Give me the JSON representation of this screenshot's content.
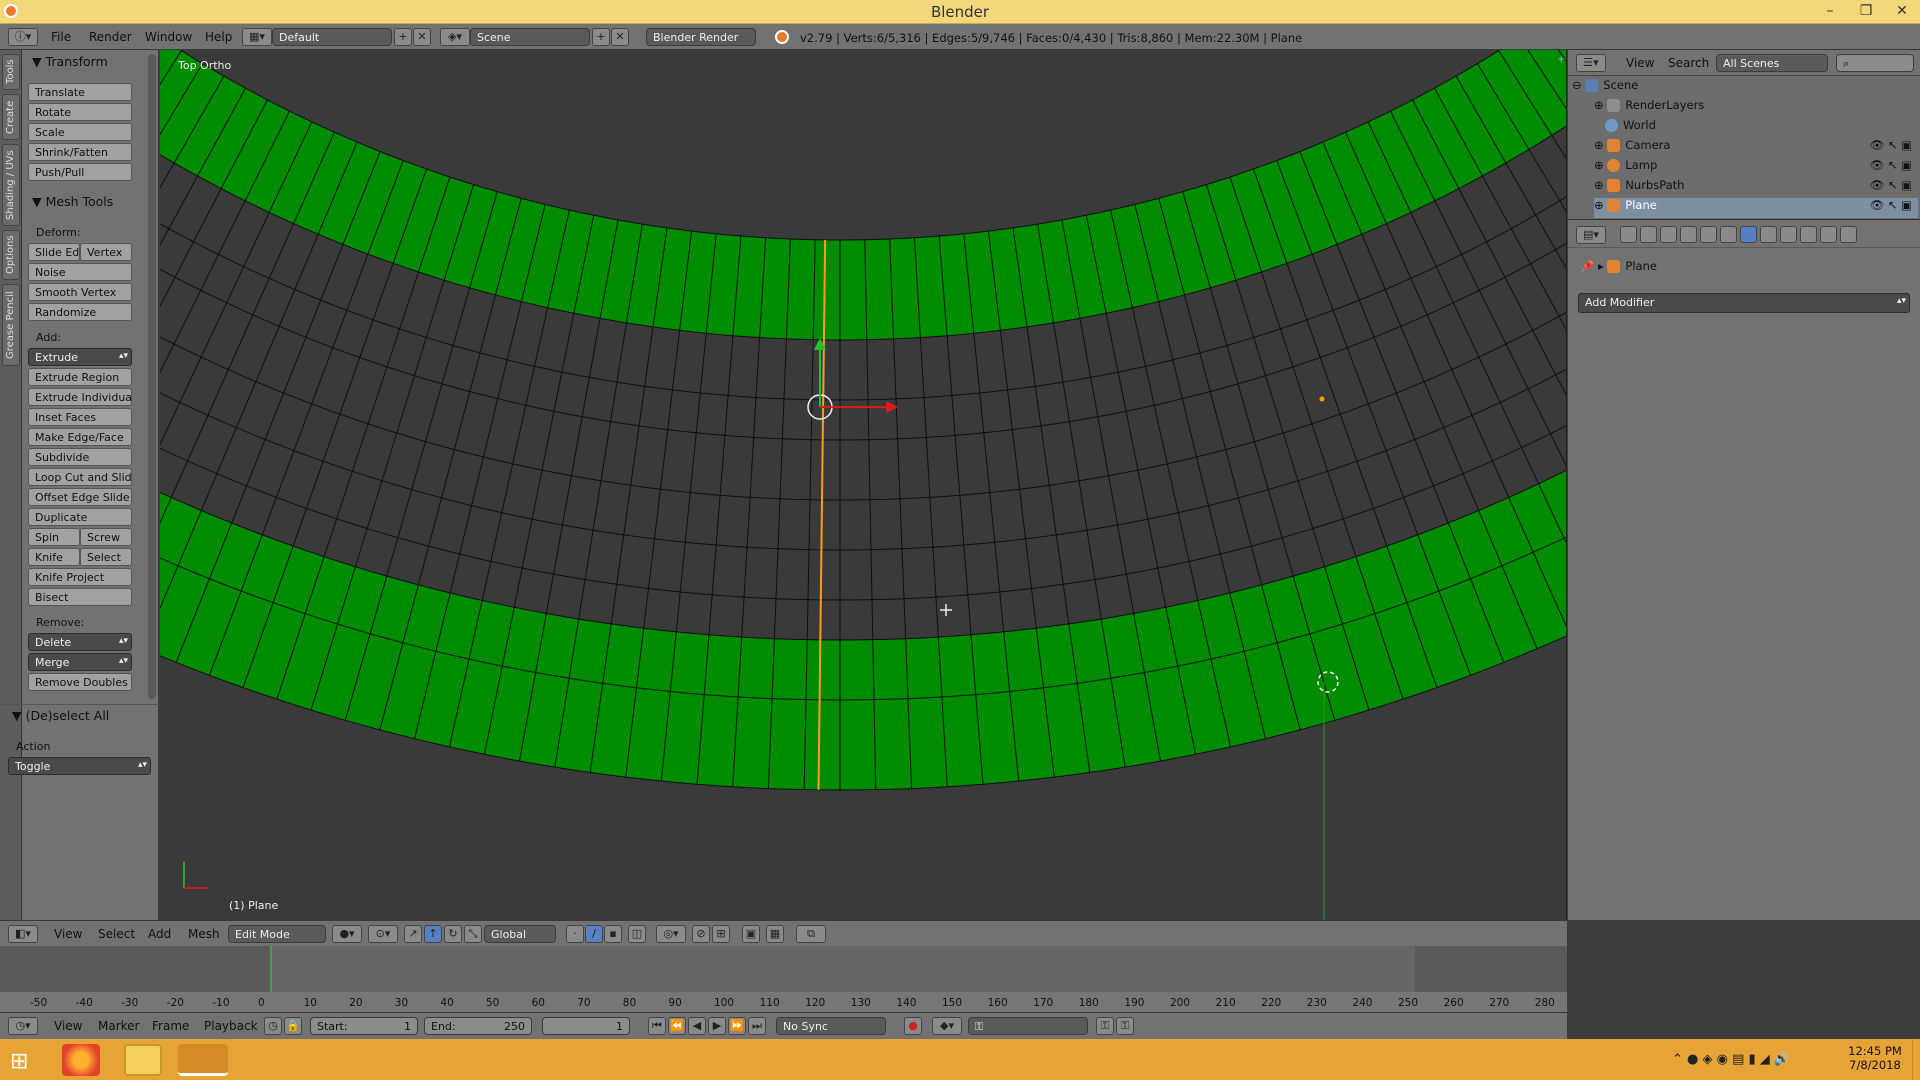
{
  "window": {
    "title": "Blender"
  },
  "info": {
    "menu": [
      "File",
      "Render",
      "Window",
      "Help"
    ],
    "layout_name": "Default",
    "scene_name": "Scene",
    "render_engine": "Blender Render",
    "stats": "v2.79 | Verts:6/5,316 | Edges:5/9,746 | Faces:0/4,430 | Tris:8,860 | Mem:22.30M | Plane"
  },
  "toolshelf": {
    "tabs": [
      "Tools",
      "Create",
      "Shading / UVs",
      "Options",
      "Grease Pencil"
    ],
    "transform_title": "Transform",
    "transform": [
      "Translate",
      "Rotate",
      "Scale",
      "Shrink/Fatten",
      "Push/Pull"
    ],
    "mesh_tools_title": "Mesh Tools",
    "deform_label": "Deform:",
    "deform": [
      "Slide Ed",
      "Vertex",
      "Noise",
      "Smooth Vertex",
      "Randomize"
    ],
    "add_label": "Add:",
    "add": [
      "Extrude",
      "Extrude Region",
      "Extrude Individual",
      "Inset Faces",
      "Make Edge/Face",
      "Subdivide",
      "Loop Cut and Slide",
      "Offset Edge Slide",
      "Duplicate",
      "Spin",
      "Screw",
      "Knife",
      "Select",
      "Knife Project",
      "Bisect"
    ],
    "remove_label": "Remove:",
    "remove": [
      "Delete",
      "Merge",
      "Remove Doubles"
    ],
    "deselect_title": "(De)select All",
    "action_label": "Action",
    "action_value": "Toggle"
  },
  "viewport": {
    "view_label": "Top Ortho",
    "object_label": "(1) Plane",
    "face_color": "#008c00",
    "edge_select_color": "#ff9b1a"
  },
  "outliner": {
    "menu": [
      "View",
      "Search"
    ],
    "scenes_dropdown": "All Scenes",
    "items": [
      "Scene",
      "RenderLayers",
      "World",
      "Camera",
      "Lamp",
      "NurbsPath",
      "Plane"
    ]
  },
  "properties": {
    "breadcrumb": "Plane",
    "add_modifier": "Add Modifier"
  },
  "viewport_header": {
    "menu": [
      "View",
      "Select",
      "Add",
      "Mesh"
    ],
    "mode": "Edit Mode",
    "orientation": "Global"
  },
  "timeline": {
    "ticks": [
      "-50",
      "-40",
      "-30",
      "-20",
      "-10",
      "0",
      "10",
      "20",
      "30",
      "40",
      "50",
      "60",
      "70",
      "80",
      "90",
      "100",
      "110",
      "120",
      "130",
      "140",
      "150",
      "160",
      "170",
      "180",
      "190",
      "200",
      "210",
      "220",
      "230",
      "240",
      "250",
      "260",
      "270",
      "280"
    ],
    "menu": [
      "View",
      "Marker",
      "Frame",
      "Playback"
    ],
    "start_label": "Start:",
    "start_value": "1",
    "end_label": "End:",
    "end_value": "250",
    "current_frame": "1",
    "sync": "No Sync"
  },
  "taskbar": {
    "time": "12:45 PM",
    "date": "7/8/2018"
  }
}
